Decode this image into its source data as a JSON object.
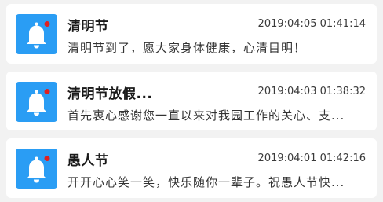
{
  "notifications": [
    {
      "icon": "bell-icon",
      "title": "清明节",
      "time": "2019:04:05 01:41:14",
      "preview": "清明节到了，愿大家身体健康，心清目明！"
    },
    {
      "icon": "bell-icon",
      "title": "清明节放假...",
      "time": "2019:04:03 01:38:32",
      "preview": "首先衷心感谢您一直以来对我园工作的关心、支..."
    },
    {
      "icon": "bell-icon",
      "title": "愚人节",
      "time": "2019:04:01 01:42:16",
      "preview": "开开心心笑一笑，快乐随你一辈子。祝愚人节快..."
    }
  ],
  "colors": {
    "icon_bg": "#2a9df4",
    "badge": "#e02020",
    "background": "#f2f2f2"
  }
}
